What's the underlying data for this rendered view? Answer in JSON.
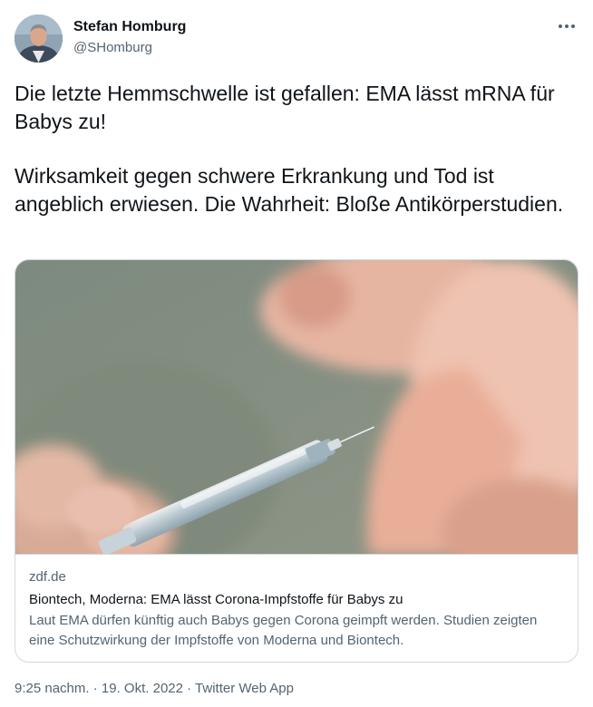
{
  "author": {
    "name": "Stefan Homburg",
    "handle": "@SHomburg",
    "avatar_icon": "profile-photo"
  },
  "more_icon": "more-dots-icon",
  "tweet": {
    "paragraph1": "Die letzte Hemmschwelle ist gefallen: EMA lässt mRNA für Babys zu!",
    "paragraph2": "Wirksamkeit gegen schwere Erkrankung und Tod ist angeblich erwiesen. Die Wahrheit: Bloße Antikörperstudien."
  },
  "card": {
    "image_subject": "syringe-baby-photo",
    "domain": "zdf.de",
    "title": "Biontech, Moderna: EMA lässt Corona-Impfstoffe für Babys zu",
    "description": "Laut EMA dürfen künftig auch Babys gegen Corona geimpft werden. Studien zeigten eine Schutzwirkung der Impfstoffe von Moderna und Biontech."
  },
  "meta": {
    "time": "9:25 nachm.",
    "separator": " · ",
    "date": "19. Okt. 2022",
    "source": "Twitter Web App"
  },
  "colors": {
    "primary_text": "#0f1419",
    "secondary_text": "#536471",
    "border": "#cfd9de",
    "background": "#ffffff"
  }
}
